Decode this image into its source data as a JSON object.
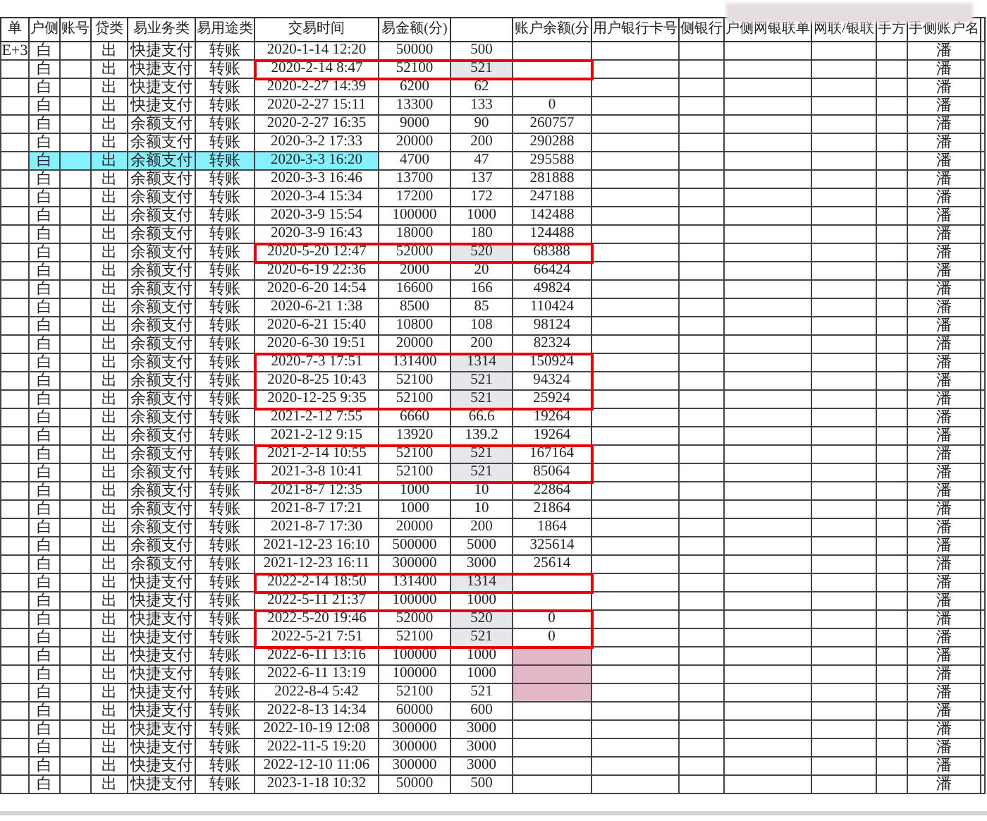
{
  "table": {
    "columns": [
      "单",
      "户侧",
      "账号",
      "贷类",
      "易业务类",
      "易用途类",
      "交易时间",
      "易金额(分)",
      "",
      "账户余额(分",
      "用户银行卡号",
      "侧银行",
      "户侧网银联单",
      "网联/银联",
      "手方",
      "手侧账户名",
      ""
    ],
    "rows": [
      {
        "column_1": "E+3",
        "side": "白",
        "direction": "出",
        "business_type": "快捷支付",
        "purpose": "转账",
        "time": "2020-1-14 12:20",
        "amount": "50000",
        "amount_yuan": "500",
        "counterparty": "潘",
        "boxed": false,
        "highlighted": false,
        "redacted": false
      },
      {
        "side": "白",
        "direction": "出",
        "business_type": "快捷支付",
        "purpose": "转账",
        "time": "2020-2-14 8:47",
        "amount": "52100",
        "amount_yuan": "521",
        "counterparty": "潘",
        "boxed": true,
        "highlighted": false,
        "redacted": false
      },
      {
        "side": "白",
        "direction": "出",
        "business_type": "快捷支付",
        "purpose": "转账",
        "time": "2020-2-27 14:39",
        "amount": "6200",
        "amount_yuan": "62",
        "counterparty": "潘",
        "boxed": false,
        "highlighted": false,
        "redacted": false
      },
      {
        "side": "白",
        "direction": "出",
        "business_type": "快捷支付",
        "purpose": "转账",
        "time": "2020-2-27 15:11",
        "amount": "13300",
        "amount_yuan": "133",
        "balance": "0",
        "counterparty": "潘",
        "boxed": false,
        "highlighted": false,
        "redacted": false
      },
      {
        "side": "白",
        "direction": "出",
        "business_type": "余额支付",
        "purpose": "转账",
        "time": "2020-2-27 16:35",
        "amount": "9000",
        "amount_yuan": "90",
        "balance": "260757",
        "counterparty": "潘",
        "boxed": false,
        "highlighted": false,
        "redacted": false
      },
      {
        "side": "白",
        "direction": "出",
        "business_type": "余额支付",
        "purpose": "转账",
        "time": "2020-3-2 17:33",
        "amount": "20000",
        "amount_yuan": "200",
        "balance": "290288",
        "counterparty": "潘",
        "boxed": false,
        "highlighted": false,
        "redacted": false
      },
      {
        "side": "白",
        "direction": "出",
        "business_type": "余额支付",
        "purpose": "转账",
        "time": "2020-3-3 16:20",
        "amount": "4700",
        "amount_yuan": "47",
        "balance": "295588",
        "counterparty": "潘",
        "boxed": false,
        "highlighted": true,
        "redacted": false
      },
      {
        "side": "白",
        "direction": "出",
        "business_type": "余额支付",
        "purpose": "转账",
        "time": "2020-3-3 16:46",
        "amount": "13700",
        "amount_yuan": "137",
        "balance": "281888",
        "counterparty": "潘",
        "boxed": false,
        "highlighted": false,
        "redacted": false
      },
      {
        "side": "白",
        "direction": "出",
        "business_type": "余额支付",
        "purpose": "转账",
        "time": "2020-3-4 15:34",
        "amount": "17200",
        "amount_yuan": "172",
        "balance": "247188",
        "counterparty": "潘",
        "boxed": false,
        "highlighted": false,
        "redacted": false
      },
      {
        "side": "白",
        "direction": "出",
        "business_type": "余额支付",
        "purpose": "转账",
        "time": "2020-3-9 15:54",
        "amount": "100000",
        "amount_yuan": "1000",
        "balance": "142488",
        "counterparty": "潘",
        "boxed": false,
        "highlighted": false,
        "redacted": false
      },
      {
        "side": "白",
        "direction": "出",
        "business_type": "余额支付",
        "purpose": "转账",
        "time": "2020-3-9 16:43",
        "amount": "18000",
        "amount_yuan": "180",
        "balance": "124488",
        "counterparty": "潘",
        "boxed": false,
        "highlighted": false,
        "redacted": false
      },
      {
        "side": "白",
        "direction": "出",
        "business_type": "余额支付",
        "purpose": "转账",
        "time": "2020-5-20 12:47",
        "amount": "52000",
        "amount_yuan": "520",
        "balance": "68388",
        "counterparty": "潘",
        "boxed": true,
        "highlighted": false,
        "redacted": false
      },
      {
        "side": "白",
        "direction": "出",
        "business_type": "余额支付",
        "purpose": "转账",
        "time": "2020-6-19 22:36",
        "amount": "2000",
        "amount_yuan": "20",
        "balance": "66424",
        "counterparty": "潘",
        "boxed": false,
        "highlighted": false,
        "redacted": false
      },
      {
        "side": "白",
        "direction": "出",
        "business_type": "余额支付",
        "purpose": "转账",
        "time": "2020-6-20 14:54",
        "amount": "16600",
        "amount_yuan": "166",
        "balance": "49824",
        "counterparty": "潘",
        "boxed": false,
        "highlighted": false,
        "redacted": false
      },
      {
        "side": "白",
        "direction": "出",
        "business_type": "余额支付",
        "purpose": "转账",
        "time": "2020-6-21 1:38",
        "amount": "8500",
        "amount_yuan": "85",
        "balance": "110424",
        "counterparty": "潘",
        "boxed": false,
        "highlighted": false,
        "redacted": false
      },
      {
        "side": "白",
        "direction": "出",
        "business_type": "余额支付",
        "purpose": "转账",
        "time": "2020-6-21 15:40",
        "amount": "10800",
        "amount_yuan": "108",
        "balance": "98124",
        "counterparty": "潘",
        "boxed": false,
        "highlighted": false,
        "redacted": false
      },
      {
        "side": "白",
        "direction": "出",
        "business_type": "余额支付",
        "purpose": "转账",
        "time": "2020-6-30 19:51",
        "amount": "20000",
        "amount_yuan": "200",
        "balance": "82324",
        "counterparty": "潘",
        "boxed": false,
        "highlighted": false,
        "redacted": false
      },
      {
        "side": "白",
        "direction": "出",
        "business_type": "余额支付",
        "purpose": "转账",
        "time": "2020-7-3 17:51",
        "amount": "131400",
        "amount_yuan": "1314",
        "balance": "150924",
        "counterparty": "潘",
        "boxed": true,
        "highlighted": false,
        "redacted": false
      },
      {
        "side": "白",
        "direction": "出",
        "business_type": "余额支付",
        "purpose": "转账",
        "time": "2020-8-25 10:43",
        "amount": "52100",
        "amount_yuan": "521",
        "balance": "94324",
        "counterparty": "潘",
        "boxed": true,
        "highlighted": false,
        "redacted": false
      },
      {
        "side": "白",
        "direction": "出",
        "business_type": "余额支付",
        "purpose": "转账",
        "time": "2020-12-25 9:35",
        "amount": "52100",
        "amount_yuan": "521",
        "balance": "25924",
        "counterparty": "潘",
        "boxed": true,
        "highlighted": false,
        "redacted": false
      },
      {
        "side": "白",
        "direction": "出",
        "business_type": "余额支付",
        "purpose": "转账",
        "time": "2021-2-12 7:55",
        "amount": "6660",
        "amount_yuan": "66.6",
        "balance": "19264",
        "counterparty": "潘",
        "boxed": false,
        "highlighted": false,
        "redacted": false
      },
      {
        "side": "白",
        "direction": "出",
        "business_type": "余额支付",
        "purpose": "转账",
        "time": "2021-2-12 9:15",
        "amount": "13920",
        "amount_yuan": "139.2",
        "balance": "19264",
        "counterparty": "潘",
        "boxed": false,
        "highlighted": false,
        "redacted": false
      },
      {
        "side": "白",
        "direction": "出",
        "business_type": "余额支付",
        "purpose": "转账",
        "time": "2021-2-14 10:55",
        "amount": "52100",
        "amount_yuan": "521",
        "balance": "167164",
        "counterparty": "潘",
        "boxed": true,
        "highlighted": false,
        "redacted": false
      },
      {
        "side": "白",
        "direction": "出",
        "business_type": "余额支付",
        "purpose": "转账",
        "time": "2021-3-8 10:41",
        "amount": "52100",
        "amount_yuan": "521",
        "balance": "85064",
        "counterparty": "潘",
        "boxed": true,
        "highlighted": false,
        "redacted": false
      },
      {
        "side": "白",
        "direction": "出",
        "business_type": "余额支付",
        "purpose": "转账",
        "time": "2021-8-7 12:35",
        "amount": "1000",
        "amount_yuan": "10",
        "balance": "22864",
        "counterparty": "潘",
        "boxed": false,
        "highlighted": false,
        "redacted": false
      },
      {
        "side": "白",
        "direction": "出",
        "business_type": "余额支付",
        "purpose": "转账",
        "time": "2021-8-7 17:21",
        "amount": "1000",
        "amount_yuan": "10",
        "balance": "21864",
        "counterparty": "潘",
        "boxed": false,
        "highlighted": false,
        "redacted": false
      },
      {
        "side": "白",
        "direction": "出",
        "business_type": "余额支付",
        "purpose": "转账",
        "time": "2021-8-7 17:30",
        "amount": "20000",
        "amount_yuan": "200",
        "balance": "1864",
        "counterparty": "潘",
        "boxed": false,
        "highlighted": false,
        "redacted": false
      },
      {
        "side": "白",
        "direction": "出",
        "business_type": "余额支付",
        "purpose": "转账",
        "time": "2021-12-23 16:10",
        "amount": "500000",
        "amount_yuan": "5000",
        "balance": "325614",
        "counterparty": "潘",
        "boxed": false,
        "highlighted": false,
        "redacted": false
      },
      {
        "side": "白",
        "direction": "出",
        "business_type": "余额支付",
        "purpose": "转账",
        "time": "2021-12-23 16:11",
        "amount": "300000",
        "amount_yuan": "3000",
        "balance": "25614",
        "counterparty": "潘",
        "boxed": false,
        "highlighted": false,
        "redacted": false
      },
      {
        "side": "白",
        "direction": "出",
        "business_type": "快捷支付",
        "purpose": "转账",
        "time": "2022-2-14 18:50",
        "amount": "131400",
        "amount_yuan": "1314",
        "counterparty": "潘",
        "boxed": true,
        "highlighted": false,
        "redacted": false
      },
      {
        "side": "白",
        "direction": "出",
        "business_type": "快捷支付",
        "purpose": "转账",
        "time": "2022-5-11 21:37",
        "amount": "100000",
        "amount_yuan": "1000",
        "counterparty": "潘",
        "boxed": false,
        "highlighted": false,
        "redacted": false
      },
      {
        "side": "白",
        "direction": "出",
        "business_type": "快捷支付",
        "purpose": "转账",
        "time": "2022-5-20 19:46",
        "amount": "52000",
        "amount_yuan": "520",
        "balance": "0",
        "counterparty": "潘",
        "boxed": true,
        "highlighted": false,
        "redacted": false
      },
      {
        "side": "白",
        "direction": "出",
        "business_type": "快捷支付",
        "purpose": "转账",
        "time": "2022-5-21 7:51",
        "amount": "52100",
        "amount_yuan": "521",
        "balance": "0",
        "counterparty": "潘",
        "boxed": true,
        "highlighted": false,
        "redacted": false
      },
      {
        "side": "白",
        "direction": "出",
        "business_type": "快捷支付",
        "purpose": "转账",
        "time": "2022-6-11 13:16",
        "amount": "100000",
        "amount_yuan": "1000",
        "counterparty": "潘",
        "boxed": false,
        "highlighted": false,
        "redacted": true
      },
      {
        "side": "白",
        "direction": "出",
        "business_type": "快捷支付",
        "purpose": "转账",
        "time": "2022-6-11 13:19",
        "amount": "100000",
        "amount_yuan": "1000",
        "counterparty": "潘",
        "boxed": false,
        "highlighted": false,
        "redacted": true
      },
      {
        "side": "白",
        "direction": "出",
        "business_type": "快捷支付",
        "purpose": "转账",
        "time": "2022-8-4 5:42",
        "amount": "52100",
        "amount_yuan": "521",
        "counterparty": "潘",
        "boxed": false,
        "highlighted": false,
        "redacted": true
      },
      {
        "side": "白",
        "direction": "出",
        "business_type": "快捷支付",
        "purpose": "转账",
        "time": "2022-8-13 14:34",
        "amount": "60000",
        "amount_yuan": "600",
        "counterparty": "潘",
        "boxed": false,
        "highlighted": false,
        "redacted": false
      },
      {
        "side": "白",
        "direction": "出",
        "business_type": "快捷支付",
        "purpose": "转账",
        "time": "2022-10-19 12:08",
        "amount": "300000",
        "amount_yuan": "3000",
        "counterparty": "潘",
        "boxed": false,
        "highlighted": false,
        "redacted": false
      },
      {
        "side": "白",
        "direction": "出",
        "business_type": "快捷支付",
        "purpose": "转账",
        "time": "2022-11-5 19:20",
        "amount": "300000",
        "amount_yuan": "3000",
        "counterparty": "潘",
        "boxed": false,
        "highlighted": false,
        "redacted": false
      },
      {
        "side": "白",
        "direction": "出",
        "business_type": "快捷支付",
        "purpose": "转账",
        "time": "2022-12-10 11:06",
        "amount": "300000",
        "amount_yuan": "3000",
        "counterparty": "潘",
        "boxed": false,
        "highlighted": false,
        "redacted": false
      },
      {
        "side": "白",
        "direction": "出",
        "business_type": "快捷支付",
        "purpose": "转账",
        "time": "2023-1-18 10:32",
        "amount": "50000",
        "amount_yuan": "500",
        "counterparty": "潘",
        "boxed": false,
        "highlighted": false,
        "redacted": false
      }
    ]
  }
}
